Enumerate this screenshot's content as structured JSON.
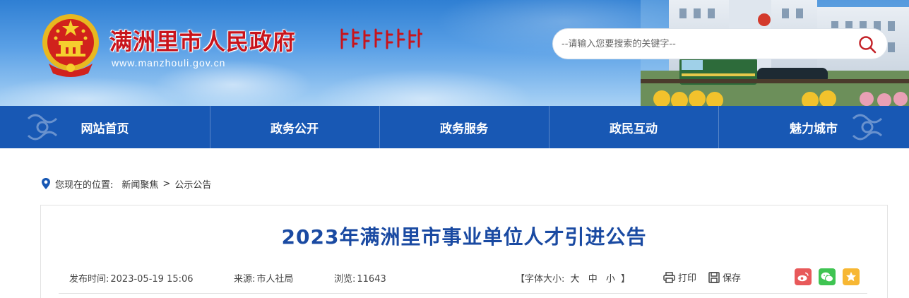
{
  "header": {
    "site_title": "满洲里市人民政府",
    "site_url": "www.manzhouli.gov.cn",
    "search": {
      "placeholder": "--请输入您要搜索的关键字--"
    }
  },
  "nav": {
    "items": [
      {
        "label": "网站首页"
      },
      {
        "label": "政务公开"
      },
      {
        "label": "政务服务"
      },
      {
        "label": "政民互动"
      },
      {
        "label": "魅力城市"
      }
    ]
  },
  "breadcrumb": {
    "prefix": "您现在的位置:",
    "items": [
      "新闻聚焦",
      "公示公告"
    ],
    "separator": ">"
  },
  "article": {
    "title": "2023年满洲里市事业单位人才引进公告",
    "publish_label": "发布时间:",
    "publish_time": "2023-05-19 15:06",
    "source_label": "来源:",
    "source": "市人社局",
    "views_label": "浏览:",
    "views": "11643",
    "fontsize": {
      "open": "【字体大小:",
      "large": "大",
      "medium": "中",
      "small": "小",
      "close": "】"
    },
    "print_label": "打印",
    "save_label": "保存"
  },
  "colors": {
    "nav_bg": "#1858b4",
    "title": "#1a4aa2",
    "site_title": "#c8141c",
    "weibo": "#e8595a",
    "wechat": "#3fc452",
    "favorite": "#f7b733"
  }
}
